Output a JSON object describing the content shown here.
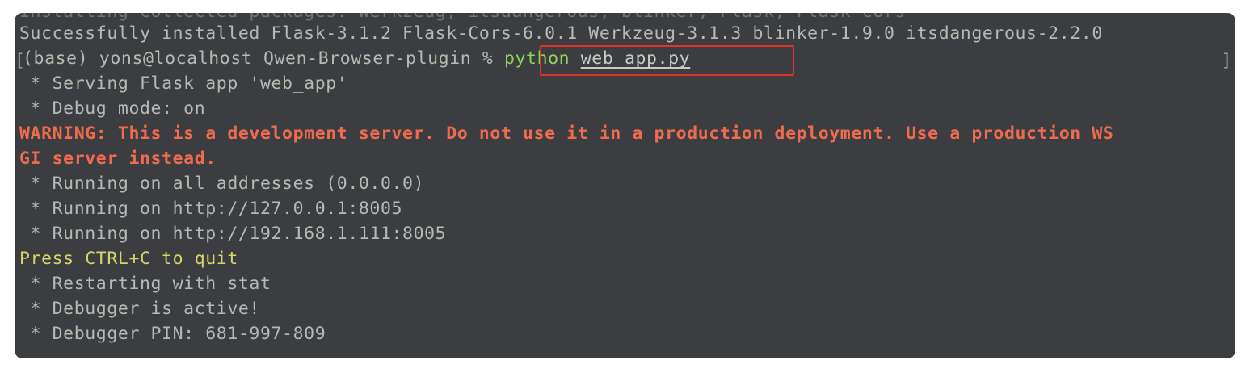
{
  "terminal": {
    "ghost_line": "Installing collected packages: Werkzeug, itsdangerous, blinker, Flask, Flask-Cors",
    "lines": [
      "Successfully installed Flask-3.1.2 Flask-Cors-6.0.1 Werkzeug-3.1.3 blinker-1.9.0 itsdangerous-2.2.0",
      "(base) yons@localhost Qwen-Browser-plugin % ",
      " * Serving Flask app 'web_app'",
      " * Debug mode: on",
      "WARNING: This is a development server. Do not use it in a production deployment. Use a production WS",
      "GI server instead.",
      " * Running on all addresses (0.0.0.0)",
      " * Running on http://127.0.0.1:8005",
      " * Running on http://192.168.1.111:8005",
      "Press CTRL+C to quit",
      " * Restarting with stat",
      " * Debugger is active!",
      " * Debugger PIN: 681-997-809"
    ],
    "prompt_bracket_left": "[",
    "prompt_bracket_right": "]",
    "command": {
      "program": "python",
      "argument": "web_app.py"
    }
  },
  "colors": {
    "background": "#3b3d41",
    "text": "#c8cbc4",
    "warning": "#ee6b4d",
    "notice": "#d8d66a",
    "command": "#8fd45a",
    "highlight_border": "#e0352b"
  }
}
